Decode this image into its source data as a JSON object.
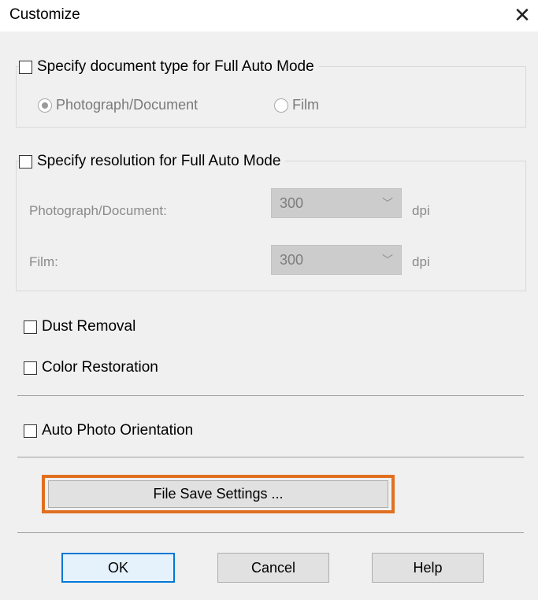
{
  "window": {
    "title": "Customize",
    "close_glyph": "✕"
  },
  "doc_type": {
    "checkbox_label": "Specify document type for Full Auto Mode",
    "options": [
      "Photograph/Document",
      "Film"
    ],
    "selected": "Photograph/Document"
  },
  "resolution": {
    "checkbox_label": "Specify resolution for Full Auto Mode",
    "rows": [
      {
        "label": "Photograph/Document:",
        "value": "300",
        "unit": "dpi"
      },
      {
        "label": "Film:",
        "value": "300",
        "unit": "dpi"
      }
    ]
  },
  "options": {
    "dust_removal": "Dust Removal",
    "color_restoration": "Color Restoration",
    "auto_photo_orientation": "Auto Photo Orientation"
  },
  "file_save_button": "File Save Settings ...",
  "buttons": {
    "ok": "OK",
    "cancel": "Cancel",
    "help": "Help"
  },
  "colors": {
    "highlight": "#e07020",
    "default_button_border": "#0078d7"
  }
}
